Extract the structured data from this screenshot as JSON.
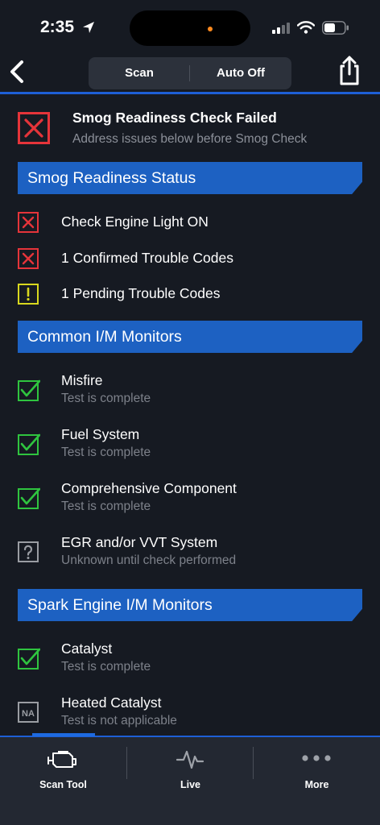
{
  "status_bar": {
    "time": "2:35"
  },
  "nav": {
    "scan_label": "Scan",
    "auto_off_label": "Auto Off"
  },
  "summary": {
    "title": "Smog Readiness Check Failed",
    "subtitle": "Address issues below before Smog Check"
  },
  "sections": {
    "readiness": {
      "title": "Smog Readiness Status",
      "items": [
        {
          "label": "Check Engine Light ON",
          "status": "fail"
        },
        {
          "label": "1 Confirmed Trouble Codes",
          "status": "fail"
        },
        {
          "label": "1 Pending Trouble Codes",
          "status": "warning"
        }
      ]
    },
    "common": {
      "title": "Common I/M Monitors",
      "items": [
        {
          "label": "Misfire",
          "sub": "Test is complete",
          "status": "complete"
        },
        {
          "label": "Fuel System",
          "sub": "Test is complete",
          "status": "complete"
        },
        {
          "label": "Comprehensive Component",
          "sub": "Test is complete",
          "status": "complete"
        },
        {
          "label": "EGR and/or VVT System",
          "sub": "Unknown until check performed",
          "status": "unknown"
        }
      ]
    },
    "spark": {
      "title": "Spark Engine I/M Monitors",
      "items": [
        {
          "label": "Catalyst",
          "sub": "Test is complete",
          "status": "complete"
        },
        {
          "label": "Heated Catalyst",
          "sub": "Test is not applicable",
          "status": "na",
          "icon_text": "NA"
        }
      ]
    }
  },
  "tabs": [
    {
      "label": "Scan Tool",
      "icon": "engine-icon",
      "selected": true
    },
    {
      "label": "Live",
      "icon": "pulse-icon"
    },
    {
      "label": "More",
      "icon": "more-dots-icon"
    }
  ],
  "colors": {
    "accent": "#1e5fd6",
    "section_header": "#1d61c2",
    "fail": "#e5343a",
    "warning": "#d8d81e",
    "complete": "#2fc43f",
    "neutral": "#9a9da3",
    "background": "#161a22",
    "tab_bar": "#232832"
  }
}
